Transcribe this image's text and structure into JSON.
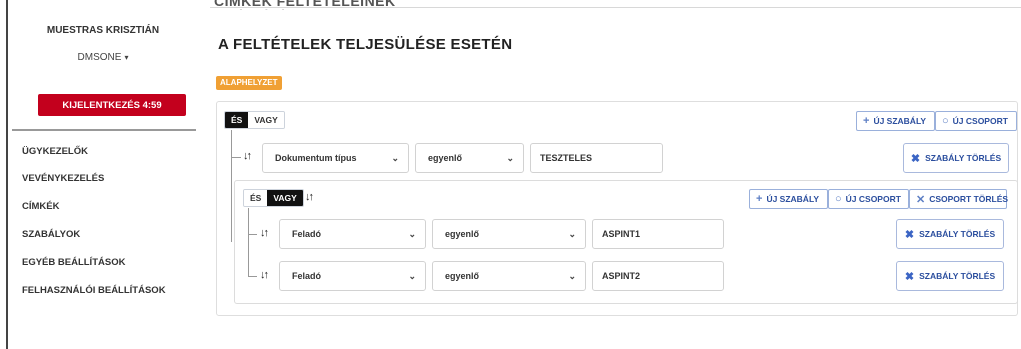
{
  "sidebar": {
    "user_name": "MUESTRAS KRISZTIÁN",
    "org": "DMSONE",
    "logout_label": "KIJELENTKEZÉS 4:59",
    "menu": [
      "ÜGYKEZELŐK",
      "VEVÉNYKEZELÉS",
      "CÍMKÉK",
      "SZABÁLYOK",
      "EGYÉB BEÁLLÍTÁSOK",
      "FELHASZNÁLÓI BEÁLLÍTÁSOK"
    ]
  },
  "main": {
    "cut_title": "CÍMKÉK FELTÉTELEINEK BEÁLLÍTÁSA",
    "title": "A FELTÉTELEK TELJESÜLÉSE ESETÉN",
    "badge": "ALAPHELYZET",
    "root_group": {
      "logic_and": "ÉS",
      "logic_or": "VAGY",
      "active_logic": "ÉS",
      "new_rule_label": "ÚJ SZABÁLY",
      "new_group_label": "ÚJ CSOPORT",
      "rule": {
        "field": "Dokumentum típus",
        "operator": "egyenlő",
        "value": "TESZTELES",
        "delete_label": "SZABÁLY TÖRLÉS"
      }
    },
    "sub_group": {
      "logic_and": "ÉS",
      "logic_or": "VAGY",
      "active_logic": "VAGY",
      "new_rule_label": "ÚJ SZABÁLY",
      "new_group_label": "ÚJ CSOPORT",
      "delete_group_label": "CSOPORT TÖRLÉS",
      "rules": [
        {
          "field": "Feladó",
          "operator": "egyenlő",
          "value": "ASPINT1",
          "delete_label": "SZABÁLY TÖRLÉS"
        },
        {
          "field": "Feladó",
          "operator": "egyenlő",
          "value": "ASPINT2",
          "delete_label": "SZABÁLY TÖRLÉS"
        }
      ]
    }
  },
  "icons": {
    "sort": "sort-arrows-icon",
    "plus": "plus-icon",
    "circle": "circle-icon",
    "close": "close-icon",
    "chevron": "chevron-down-icon"
  },
  "colors": {
    "logout": "#c3001d",
    "badge": "#f0a034",
    "link_blue": "#2b4e9e",
    "active_toggle": "#111111"
  }
}
